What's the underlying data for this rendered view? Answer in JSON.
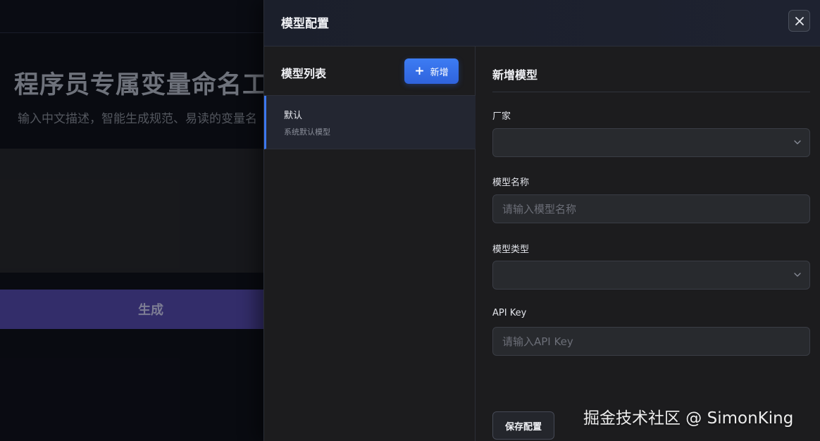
{
  "background": {
    "title": "程序员专属变量命名工具",
    "subtitle": "输入中文描述，智能生成规范、易读的变量名",
    "generate_label": "生成"
  },
  "drawer": {
    "title": "模型配置",
    "close_icon": "close-icon",
    "model_list": {
      "title": "模型列表",
      "add_label": "新增",
      "add_icon": "plus-icon",
      "items": [
        {
          "name": "默认",
          "description": "系统默认模型",
          "selected": true
        }
      ]
    },
    "form": {
      "title": "新增模型",
      "vendor": {
        "label": "厂家",
        "value": ""
      },
      "model_name": {
        "label": "模型名称",
        "placeholder": "请输入模型名称",
        "value": ""
      },
      "model_type": {
        "label": "模型类型",
        "value": ""
      },
      "api_key": {
        "label": "API Key",
        "placeholder": "请输入API Key",
        "value": ""
      },
      "save_label": "保存配置"
    }
  },
  "watermark": "掘金技术社区 @ SimonKing",
  "colors": {
    "accent": "#3c78ef",
    "generate_button": "#3b3479",
    "drawer_bg": "#1c1c1e"
  }
}
